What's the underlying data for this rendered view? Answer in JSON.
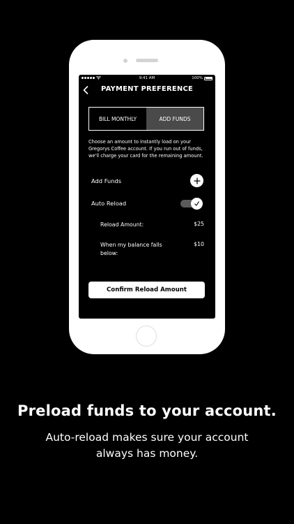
{
  "status_bar": {
    "time": "9:41 AM",
    "battery": "100%"
  },
  "nav": {
    "title": "PAYMENT PREFERENCE"
  },
  "segments": {
    "bill_monthly": "BILL MONTHLY",
    "add_funds": "ADD FUNDS",
    "selected": "ADD FUNDS"
  },
  "description": "Choose an amount to instantly load on your Gregorys Coffee account. If you run out of funds, we'll charge your card for the remaining amount.",
  "add_funds": {
    "label": "Add Funds"
  },
  "auto_reload": {
    "label": "Auto Reload",
    "enabled": true
  },
  "reload_amount": {
    "label": "Reload Amount:",
    "value": "$25"
  },
  "balance_threshold": {
    "label": "When my balance falls below:",
    "value": "$10"
  },
  "confirm_button": {
    "label": "Confirm Reload Amount"
  },
  "caption": {
    "headline": "Preload funds to your account.",
    "subline": "Auto-reload makes sure your account always has money."
  },
  "colors": {
    "background": "#000000",
    "foreground": "#ffffff",
    "segment_active": "#4a4a4a",
    "toggle_track": "#5a5a5a"
  }
}
